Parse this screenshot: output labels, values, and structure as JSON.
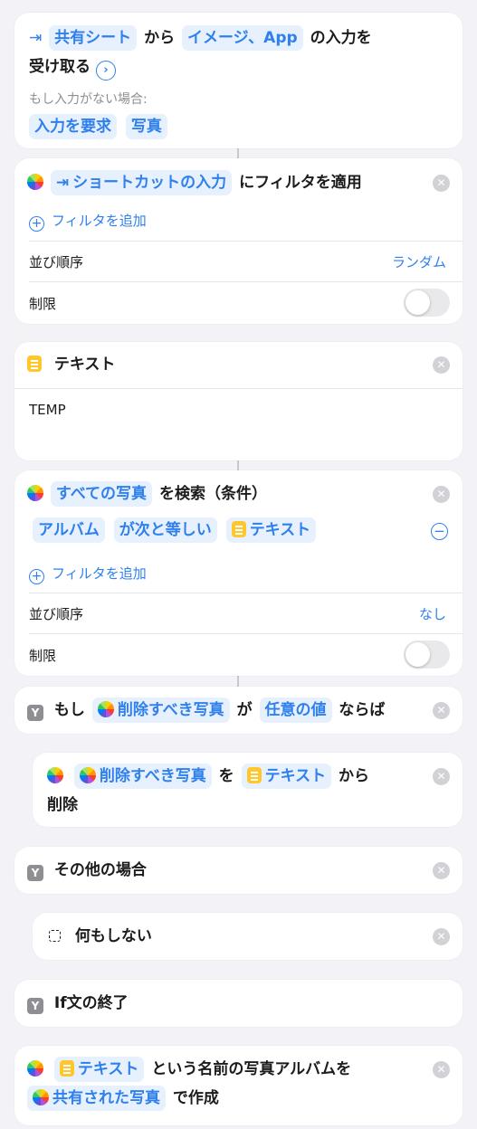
{
  "block1": {
    "source_token": "共有シート",
    "word_from": "から",
    "types_token": "イメージ、App",
    "word_input": "の入力を",
    "line2": "受け取る",
    "if_no_input": "もし入力がない場合:",
    "ask_token": "入力を要求",
    "photo_token": "写真"
  },
  "block2": {
    "input_token": "ショートカットの入力",
    "apply_text": "にフィルタを適用",
    "add_filter": "フィルタを追加",
    "sort_label": "並び順序",
    "sort_value": "ランダム",
    "limit_label": "制限"
  },
  "block3": {
    "title": "テキスト",
    "content": "TEMP"
  },
  "block4": {
    "all_photos_token": "すべての写真",
    "search_text": "を検索（条件）",
    "album_token": "アルバム",
    "condition_token": "が次と等しい",
    "text_token": "テキスト",
    "add_filter": "フィルタを追加",
    "sort_label": "並び順序",
    "sort_value": "なし",
    "limit_label": "制限"
  },
  "block5": {
    "word_if": "もし",
    "photos_token": "削除すべき写真",
    "word_ga": "が",
    "any_value_token": "任意の値",
    "word_then": "ならば"
  },
  "block6": {
    "photos_token": "削除すべき写真",
    "word_wo": "を",
    "text_token": "テキスト",
    "word_from": "から",
    "line2": "削除"
  },
  "block7": {
    "title": "その他の場合"
  },
  "block8": {
    "title": "何もしない"
  },
  "block9": {
    "title": "If文の終了"
  },
  "block10": {
    "text_token": "テキスト",
    "middle_text": "という名前の写真アルバムを",
    "shared_token": "共有された写真",
    "end_text": "で作成"
  },
  "icons": {
    "close": "close-icon",
    "photos": "photos-icon",
    "text": "text-icon",
    "if": "if-icon"
  },
  "colors": {
    "accent": "#2f80ed",
    "background": "#f2f2f7",
    "token_bg": "#e7f0fd"
  }
}
